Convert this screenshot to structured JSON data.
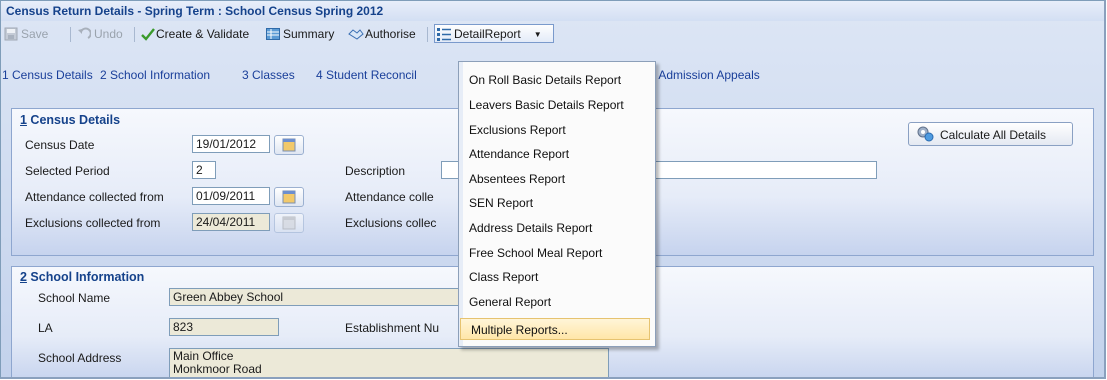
{
  "window": {
    "title": "Census Return Details - Spring Term : School Census Spring 2012"
  },
  "toolbar": {
    "save": "Save",
    "undo": "Undo",
    "create_validate": "Create & Validate",
    "summary": "Summary",
    "authorise": "Authorise",
    "detail_report": "DetailReport"
  },
  "tabs": [
    {
      "label": "1 Census Details"
    },
    {
      "label": "2 School Information"
    },
    {
      "label": "3 Classes"
    },
    {
      "label": "4 Student Reconcil"
    },
    {
      "label": "7 Admission Appeals"
    }
  ],
  "census_details": {
    "heading_num": "1",
    "heading_text": " Census Details",
    "census_date_label": "Census Date",
    "census_date": "19/01/2012",
    "selected_period_label": "Selected Period",
    "selected_period": "2",
    "description_label": "Description",
    "description_value": "",
    "attendance_from_label": "Attendance collected from",
    "attendance_from": "01/09/2011",
    "attendance_to_label": "Attendance colle",
    "exclusions_from_label": "Exclusions collected from",
    "exclusions_from": "24/04/2011",
    "exclusions_to_label": "Exclusions collec",
    "calculate_button": "Calculate All Details"
  },
  "school_information": {
    "heading_num": "2",
    "heading_text": " School Information",
    "school_name_label": "School Name",
    "school_name": "Green Abbey School",
    "la_label": "LA",
    "la": "823",
    "establishment_label": "Establishment Nu",
    "address_label": "School Address",
    "address_lines": [
      "Main Office",
      "Monkmoor Road"
    ]
  },
  "detail_report_menu": {
    "items": [
      "On Roll Basic Details Report",
      "Leavers Basic Details Report",
      "Exclusions Report",
      "Attendance Report",
      "Absentees Report",
      "SEN Report",
      "Address Details Report",
      "Free School Meal Report",
      "Class Report",
      "General Report",
      "Multiple Reports..."
    ],
    "highlighted": "Multiple Reports..."
  },
  "colors": {
    "title": "#15428b",
    "tab": "#1a3f9a",
    "highlight": "#ffe6a8"
  }
}
